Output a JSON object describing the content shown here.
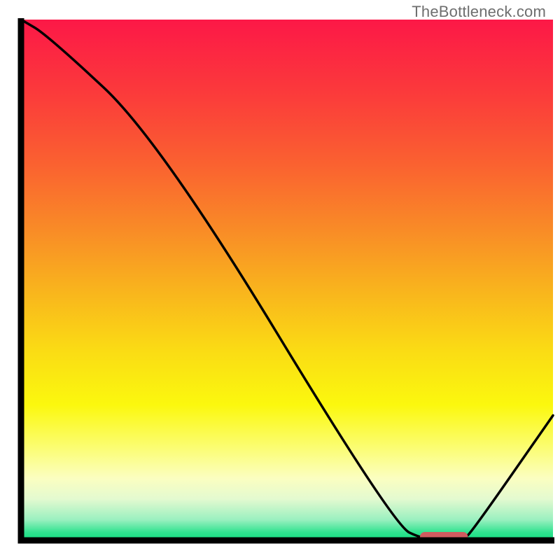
{
  "watermark": "TheBottleneck.com",
  "chart_data": {
    "type": "line",
    "title": "",
    "xlabel": "",
    "ylabel": "",
    "xlim": [
      0,
      100
    ],
    "ylim": [
      0,
      100
    ],
    "x": [
      0,
      5,
      26,
      70,
      76,
      83,
      85,
      100
    ],
    "y": [
      100,
      97,
      77,
      3,
      0,
      0,
      2,
      24
    ],
    "optimal_marker": {
      "x_start": 75,
      "x_end": 84,
      "y": 0
    },
    "gradient_stops": [
      {
        "offset": 0.0,
        "color": "#fc1847"
      },
      {
        "offset": 0.14,
        "color": "#fb3a3b"
      },
      {
        "offset": 0.28,
        "color": "#fa6230"
      },
      {
        "offset": 0.4,
        "color": "#f98a27"
      },
      {
        "offset": 0.52,
        "color": "#f9b41d"
      },
      {
        "offset": 0.64,
        "color": "#fadd14"
      },
      {
        "offset": 0.74,
        "color": "#fbf80e"
      },
      {
        "offset": 0.82,
        "color": "#fbfd70"
      },
      {
        "offset": 0.88,
        "color": "#fbfec0"
      },
      {
        "offset": 0.92,
        "color": "#e4fad0"
      },
      {
        "offset": 0.96,
        "color": "#9bf0c0"
      },
      {
        "offset": 0.985,
        "color": "#2fe28f"
      },
      {
        "offset": 1.0,
        "color": "#12dd80"
      }
    ],
    "axis_color": "#000000",
    "curve_color": "#000000",
    "marker_color": "#d05b5f"
  }
}
